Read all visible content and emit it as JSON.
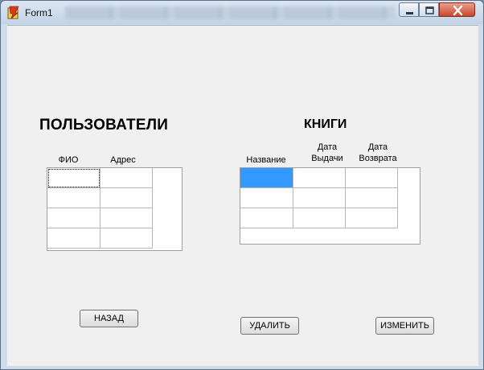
{
  "window": {
    "title": "Form1",
    "accent_close": "#c8462c"
  },
  "users": {
    "heading": "ПОЛЬЗОВАТЕЛИ",
    "columns": [
      "ФИО",
      "Адрес"
    ]
  },
  "books": {
    "heading": "КНИГИ",
    "columns": [
      "Название",
      "Дата\nВыдачи",
      "Дата\nВозврата"
    ]
  },
  "buttons": {
    "back": "НАЗАД",
    "delete": "УДАЛИТЬ",
    "edit": "ИЗМЕНИТЬ"
  },
  "colors": {
    "selection": "#3399ff",
    "client_bg": "#f0f0f0"
  }
}
